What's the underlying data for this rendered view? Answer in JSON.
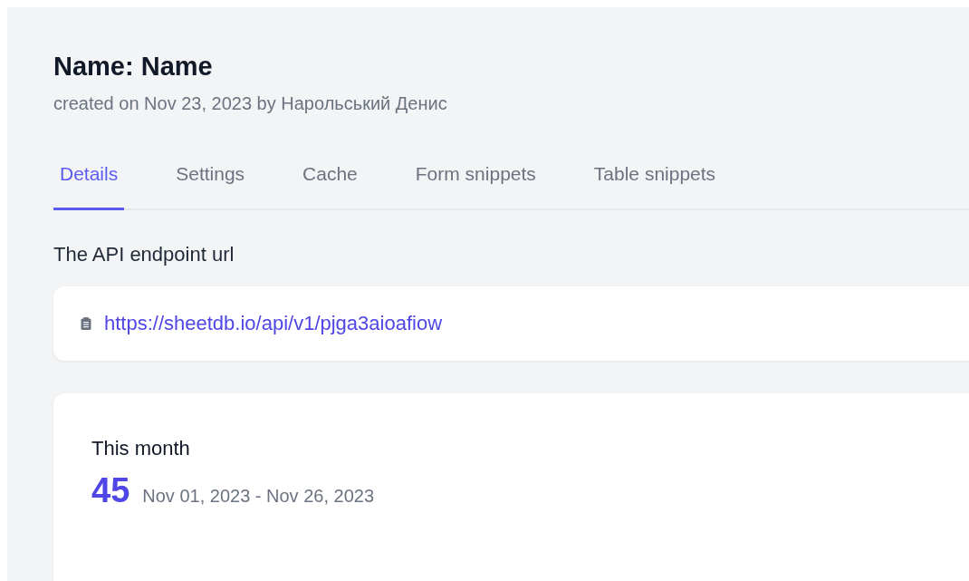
{
  "header": {
    "title": "Name: Name",
    "subtitle": "created on Nov 23, 2023 by Нарольський Денис"
  },
  "tabs": [
    {
      "label": "Details",
      "selected": true
    },
    {
      "label": "Settings",
      "selected": false
    },
    {
      "label": "Cache",
      "selected": false
    },
    {
      "label": "Form snippets",
      "selected": false
    },
    {
      "label": "Table snippets",
      "selected": false
    }
  ],
  "endpoint": {
    "label": "The API endpoint url",
    "url": "https://sheetdb.io/api/v1/pjga3aioafiow"
  },
  "stats": {
    "label": "This month",
    "count": "45",
    "range": "Nov 01, 2023 - Nov 26, 2023"
  }
}
